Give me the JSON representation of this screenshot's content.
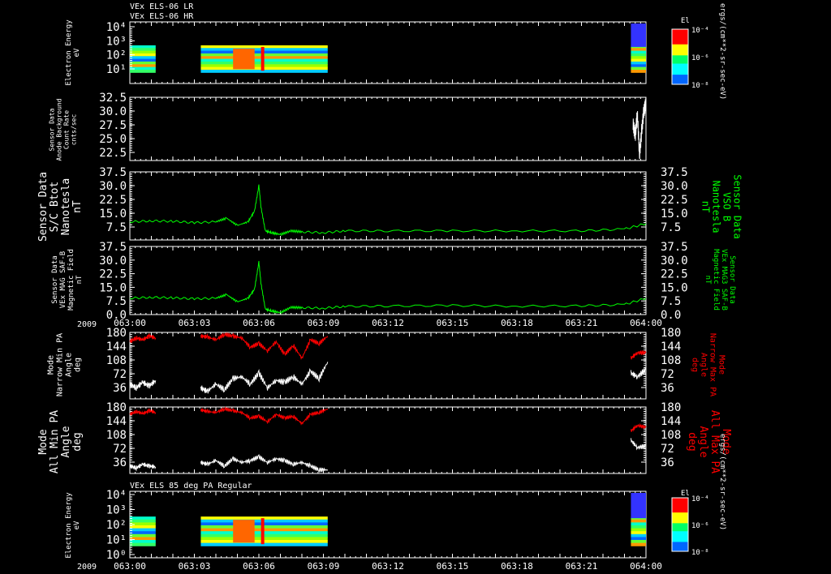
{
  "header": {
    "line1": "VEx ELS-06 LR",
    "line2": "VEx ELS-06 HR",
    "bottom_title": "VEx ELS 85 deg PA Regular"
  },
  "colors": {
    "background": "#000000",
    "axes": "#ffffff",
    "mag_trace": "#00ff00",
    "pa_max_trace": "#ff0000",
    "pa_min_trace": "#ffffff",
    "right_label_green": "#00ff00",
    "right_label_red": "#ff0000"
  },
  "x_axis": {
    "year_label": "2009",
    "ticks": [
      "063:00",
      "063:03",
      "063:06",
      "063:09",
      "063:12",
      "063:15",
      "063:18",
      "063:21",
      "064:00"
    ]
  },
  "colorbars": [
    {
      "title": "El",
      "labels": [
        "10⁻⁴",
        "10⁻⁶",
        "10⁻⁸"
      ],
      "unit": "ergs/(cm**2-sr-sec-eV)"
    },
    {
      "title": "El",
      "labels": [
        "10⁻⁴",
        "10⁻⁶",
        "10⁻⁸"
      ],
      "unit": "ergs/(cm**2-sr-sec-eV)"
    }
  ],
  "chart_data": [
    {
      "type": "heatmap",
      "name": "ELS-06 spectrogram",
      "ylabel": [
        "Electron Energy",
        "eV"
      ],
      "yticks": [
        "10⁴",
        "10³",
        "10²",
        "10¹"
      ],
      "log": true,
      "data_intervals_min": [
        [
          0,
          1.2
        ],
        [
          3.3,
          9.2
        ],
        [
          23.3,
          24
        ]
      ]
    },
    {
      "type": "line",
      "name": "Anode background",
      "ylabel": [
        "Sensor Data",
        "Anode Background",
        "Count Rate",
        "cnts/sec"
      ],
      "yticks": [
        "32.5",
        "30.0",
        "27.5",
        "25.0",
        "22.5"
      ],
      "ylim": [
        20,
        32.5
      ],
      "series": [
        {
          "values_x_min": [
            23.4,
            23.5,
            23.6,
            23.7,
            23.8,
            23.9,
            24.0
          ],
          "values": [
            27.5,
            25,
            29,
            21,
            26,
            30,
            31
          ]
        }
      ]
    },
    {
      "type": "line",
      "name": "S/C Btot",
      "ylabel": [
        "Sensor Data",
        "S/C Btot",
        "Nanotesla",
        "nT"
      ],
      "right_label": [
        "Sensor Data",
        "VSO B",
        "Nanotesla",
        "nT"
      ],
      "yticks": [
        "37.5",
        "30.0",
        "22.5",
        "15.0",
        "7.5"
      ],
      "ylim": [
        0,
        37.5
      ],
      "x_min": [
        0,
        1,
        2,
        3,
        4,
        4.5,
        5,
        5.5,
        5.8,
        6,
        6.1,
        6.3,
        6.6,
        7,
        7.5,
        8,
        9,
        10,
        12,
        15,
        18,
        21,
        23,
        24
      ],
      "values": [
        10,
        10.5,
        10.3,
        9.5,
        10,
        12,
        8,
        10,
        16,
        30,
        18,
        5,
        4,
        3,
        5,
        4.5,
        4,
        5,
        5,
        5,
        5,
        5,
        6,
        9
      ]
    },
    {
      "type": "line",
      "name": "MAG SAF-B",
      "ylabel": [
        "Sensor Data",
        "VEx MAG SAF-B",
        "Magnetic Field",
        "nT"
      ],
      "right_label": [
        "Sensor Data",
        "VEx MAG3 SAF-B",
        "Magnetic Field",
        "nT"
      ],
      "yticks": [
        "37.5",
        "30.0",
        "22.5",
        "15.0",
        "7.5",
        "0.0"
      ],
      "ylim": [
        0,
        37.5
      ],
      "x_min": [
        0,
        1,
        2,
        3,
        4,
        4.5,
        5,
        5.5,
        5.8,
        6,
        6.1,
        6.3,
        6.6,
        7,
        7.5,
        8,
        9,
        10,
        12,
        15,
        18,
        21,
        23,
        24
      ],
      "values": [
        9,
        9.5,
        9.2,
        8.7,
        9,
        11,
        7,
        9,
        14,
        29,
        17,
        3,
        2,
        1,
        4,
        3.8,
        3.5,
        4.5,
        4.7,
        5,
        4.6,
        4.8,
        5.5,
        9
      ]
    },
    {
      "type": "line",
      "name": "Narrow PA",
      "ylabel": [
        "Mode",
        "Narrow Min PA",
        "Angle",
        "deg"
      ],
      "right_label": [
        "Mode",
        "Narrow Max PA",
        "Angle",
        "deg"
      ],
      "yticks": [
        "180",
        "144",
        "108",
        "72",
        "36"
      ],
      "ylim": [
        0,
        180
      ],
      "series": [
        {
          "x_min": [
            0,
            0.3,
            0.6,
            0.9,
            1.2,
            3.3,
            3.6,
            4,
            4.4,
            4.8,
            5.2,
            5.6,
            6,
            6.4,
            6.8,
            7.2,
            7.6,
            8,
            8.4,
            8.8,
            9.2,
            23.3,
            23.6,
            24
          ],
          "values": [
            155,
            165,
            160,
            170,
            165,
            170,
            168,
            160,
            175,
            170,
            165,
            140,
            150,
            130,
            155,
            120,
            145,
            110,
            160,
            150,
            170,
            110,
            125,
            125
          ]
        },
        {
          "x_min": [
            0,
            0.3,
            0.6,
            0.9,
            1.2,
            3.3,
            3.6,
            4,
            4.4,
            4.8,
            5.2,
            5.6,
            6,
            6.4,
            6.8,
            7.2,
            7.6,
            8,
            8.4,
            8.8,
            9.2,
            23.3,
            23.6,
            24
          ],
          "values": [
            40,
            30,
            45,
            35,
            50,
            30,
            20,
            40,
            25,
            55,
            60,
            40,
            70,
            30,
            50,
            45,
            60,
            40,
            75,
            55,
            100,
            70,
            60,
            80
          ]
        }
      ]
    },
    {
      "type": "line",
      "name": "All PA",
      "ylabel": [
        "Mode",
        "All Min PA",
        "Angle",
        "deg"
      ],
      "right_label": [
        "Mode",
        "All Max PA",
        "Angle",
        "deg"
      ],
      "yticks": [
        "180",
        "144",
        "108",
        "72",
        "36"
      ],
      "ylim": [
        0,
        180
      ],
      "series": [
        {
          "x_min": [
            0,
            0.3,
            0.6,
            0.9,
            1.2,
            3.3,
            3.6,
            4,
            4.4,
            4.8,
            5.2,
            5.6,
            6,
            6.4,
            6.8,
            7.2,
            7.6,
            8,
            8.4,
            8.8,
            9.2,
            23.3,
            23.6,
            24
          ],
          "values": [
            160,
            168,
            162,
            170,
            165,
            172,
            168,
            165,
            175,
            170,
            165,
            150,
            155,
            140,
            160,
            150,
            155,
            135,
            160,
            165,
            175,
            115,
            130,
            125
          ]
        },
        {
          "x_min": [
            0,
            0.3,
            0.6,
            0.9,
            1.2,
            3.3,
            3.6,
            4,
            4.4,
            4.8,
            5.2,
            5.6,
            6,
            6.4,
            6.8,
            7.2,
            7.6,
            8,
            8.4,
            8.8,
            9.2,
            23.3,
            23.6,
            24
          ],
          "values": [
            20,
            15,
            25,
            20,
            18,
            30,
            25,
            35,
            20,
            40,
            30,
            35,
            45,
            30,
            40,
            35,
            25,
            30,
            20,
            10,
            10,
            90,
            70,
            75
          ]
        }
      ]
    },
    {
      "type": "heatmap",
      "name": "ELS 85 deg PA",
      "ylabel": [
        "Electron Energy",
        "eV"
      ],
      "yticks": [
        "10⁴",
        "10³",
        "10²",
        "10¹",
        "10⁰"
      ],
      "log": true,
      "data_intervals_min": [
        [
          0,
          1.2
        ],
        [
          3.3,
          9.2
        ],
        [
          23.3,
          24
        ]
      ]
    }
  ]
}
